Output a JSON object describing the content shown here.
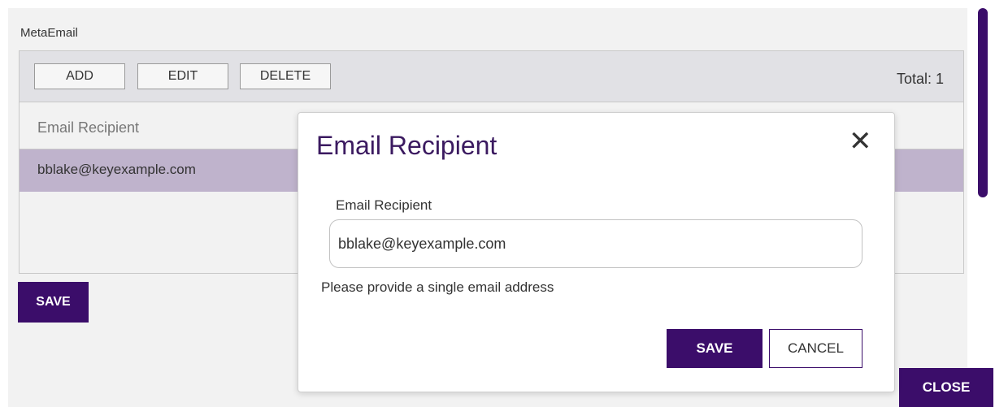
{
  "section": {
    "title": "MetaEmail"
  },
  "toolbar": {
    "add_label": "ADD",
    "edit_label": "EDIT",
    "delete_label": "DELETE",
    "total_text": "Total: 1"
  },
  "grid": {
    "column_header": "Email Recipient",
    "rows": [
      {
        "email": "bblake@keyexample.com",
        "selected": true
      }
    ]
  },
  "page_buttons": {
    "save_label": "SAVE",
    "close_label": "CLOSE"
  },
  "modal": {
    "title": "Email Recipient",
    "close_icon": "close-icon",
    "field_label": "Email Recipient",
    "field_value": "bblake@keyexample.com",
    "help_text": "Please provide a single email address",
    "save_label": "SAVE",
    "cancel_label": "CANCEL"
  },
  "colors": {
    "accent": "#3b0d6a",
    "selected_row": "#bfb3cc",
    "toolbar_bg": "#e1e1e5",
    "title_color": "#3b1a60"
  }
}
